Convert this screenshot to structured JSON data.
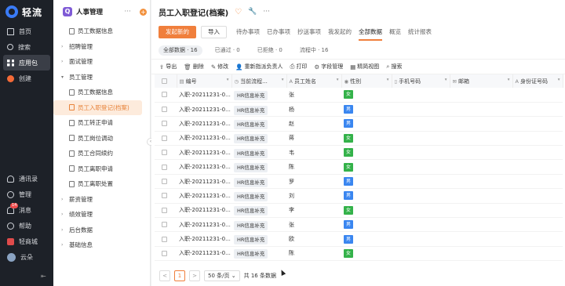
{
  "brand": {
    "name": "轻流"
  },
  "leftnav": {
    "top": [
      {
        "label": "首页",
        "icon": "home-icon"
      },
      {
        "label": "搜索",
        "icon": "search-icon"
      },
      {
        "label": "应用包",
        "icon": "apps-icon",
        "active": true
      },
      {
        "label": "创建",
        "icon": "create-icon"
      }
    ],
    "bottom": [
      {
        "label": "通讯录",
        "icon": "contacts-icon"
      },
      {
        "label": "管理",
        "icon": "manage-icon"
      },
      {
        "label": "消息",
        "icon": "bell-icon",
        "badge": "14"
      },
      {
        "label": "帮助",
        "icon": "help-icon"
      },
      {
        "label": "轻商城",
        "icon": "store-icon"
      },
      {
        "label": "云朵",
        "icon": "user-avatar-icon"
      }
    ]
  },
  "tree": {
    "app_icon_letter": "Q",
    "app_name": "人事管理",
    "items": [
      {
        "label": "员工数据信息",
        "level": 0,
        "type": "doc"
      },
      {
        "label": "招聘管理",
        "level": 0,
        "type": "group",
        "expanded": false
      },
      {
        "label": "面试管理",
        "level": 0,
        "type": "group",
        "expanded": false
      },
      {
        "label": "员工管理",
        "level": 0,
        "type": "group",
        "expanded": true
      },
      {
        "label": "员工数据信息",
        "level": 1,
        "type": "doc"
      },
      {
        "label": "员工入职登记(档案)",
        "level": 1,
        "type": "doc",
        "selected": true
      },
      {
        "label": "员工转正申请",
        "level": 1,
        "type": "doc"
      },
      {
        "label": "员工岗位调动",
        "level": 1,
        "type": "doc"
      },
      {
        "label": "员工合同续约",
        "level": 1,
        "type": "doc"
      },
      {
        "label": "员工离职申请",
        "level": 1,
        "type": "doc"
      },
      {
        "label": "员工离职处置",
        "level": 1,
        "type": "doc"
      },
      {
        "label": "薪资管理",
        "level": 0,
        "type": "group",
        "expanded": false
      },
      {
        "label": "绩效管理",
        "level": 0,
        "type": "group",
        "expanded": false
      },
      {
        "label": "后台数据",
        "level": 0,
        "type": "group",
        "expanded": false
      },
      {
        "label": "基础信息",
        "level": 0,
        "type": "group",
        "expanded": false
      }
    ]
  },
  "main": {
    "title": "员工入职登记(档案)",
    "toolbar": {
      "primary": "发起新的",
      "import": "导入",
      "tabs": [
        {
          "label": "待办事项"
        },
        {
          "label": "已办事项"
        },
        {
          "label": "抄送事项"
        },
        {
          "label": "我发起的"
        },
        {
          "label": "全部数据",
          "active": true
        },
        {
          "label": "概览"
        },
        {
          "label": "统计报表"
        }
      ]
    },
    "filters": [
      {
        "label": "全部数据 · 16",
        "active": true
      },
      {
        "label": "已通过 · 0"
      },
      {
        "label": "已拒绝 · 0"
      },
      {
        "label": "流程中 · 16"
      }
    ],
    "actions": [
      {
        "label": "导出",
        "icon": "export-icon",
        "glyph": "⇪"
      },
      {
        "label": "删除",
        "icon": "trash-icon",
        "glyph": "🗑"
      },
      {
        "label": "修改",
        "icon": "edit-icon",
        "glyph": "✎"
      },
      {
        "label": "重新指派负责人",
        "icon": "reassign-icon",
        "glyph": "👤"
      },
      {
        "label": "打印",
        "icon": "print-icon",
        "glyph": "⎙"
      },
      {
        "label": "字段管理",
        "icon": "gear-icon",
        "glyph": "⚙"
      },
      {
        "label": "精简视图",
        "icon": "grid-icon",
        "glyph": "▦"
      },
      {
        "label": "搜索",
        "icon": "search-icon",
        "glyph": "⌕"
      }
    ],
    "table": {
      "columns": [
        {
          "label": "编号",
          "icon": "id-icon",
          "glyph": "▤"
        },
        {
          "label": "当前流程...",
          "icon": "flow-icon",
          "glyph": "◷"
        },
        {
          "label": "员工姓名",
          "icon": "text-icon",
          "glyph": "A"
        },
        {
          "label": "性别",
          "icon": "radio-icon",
          "glyph": "◉"
        },
        {
          "label": "手机号码",
          "icon": "phone-icon",
          "glyph": "▯"
        },
        {
          "label": "邮箱",
          "icon": "mail-icon",
          "glyph": "✉"
        },
        {
          "label": "身份证号码",
          "icon": "text-icon",
          "glyph": "A"
        }
      ],
      "rows": [
        {
          "id": "入职-20211231-0...",
          "flow": "HR信息补充",
          "name": "张",
          "sex": "女"
        },
        {
          "id": "入职-20211231-0...",
          "flow": "HR信息补充",
          "name": "杨",
          "sex": "男"
        },
        {
          "id": "入职-20211231-0...",
          "flow": "HR信息补充",
          "name": "赵",
          "sex": "男"
        },
        {
          "id": "入职-20211231-0...",
          "flow": "HR信息补充",
          "name": "蒋",
          "sex": "女"
        },
        {
          "id": "入职-20211231-0...",
          "flow": "HR信息补充",
          "name": "韦",
          "sex": "女"
        },
        {
          "id": "入职-20211231-0...",
          "flow": "HR信息补充",
          "name": "陈",
          "sex": "女"
        },
        {
          "id": "入职-20211231-0...",
          "flow": "HR信息补充",
          "name": "罗",
          "sex": "男"
        },
        {
          "id": "入职-20211231-0...",
          "flow": "HR信息补充",
          "name": "刘",
          "sex": "男"
        },
        {
          "id": "入职-20211231-0...",
          "flow": "HR信息补充",
          "name": "李",
          "sex": "女"
        },
        {
          "id": "入职-20211231-0...",
          "flow": "HR信息补充",
          "name": "张",
          "sex": "男"
        },
        {
          "id": "入职-20211231-0...",
          "flow": "HR信息补充",
          "name": "欧",
          "sex": "男"
        },
        {
          "id": "入职-20211231-0...",
          "flow": "HR信息补充",
          "name": "陈",
          "sex": "女"
        }
      ]
    },
    "pager": {
      "prev": "<",
      "page": "1",
      "next": ">",
      "page_size": "50 条/页",
      "total": "共 16 条数据"
    }
  },
  "colors": {
    "accent": "#f07f3c",
    "male": "#3a86f0",
    "female": "#34b24a",
    "nav_bg": "#1d2128"
  }
}
